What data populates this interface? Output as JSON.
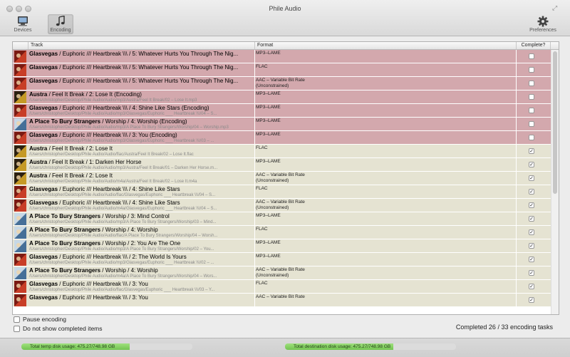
{
  "window": {
    "title": "Phile Audio"
  },
  "toolbar": {
    "devices_label": "Devices",
    "encoding_label": "Encoding",
    "preferences_label": "Preferences"
  },
  "table": {
    "headers": {
      "track": "Track",
      "format": "Format",
      "complete": "Complete?"
    },
    "rows": [
      {
        "art": "red",
        "bold": "Glasvegas",
        "rest": " / Euphoric /// Heartbreak \\\\\\ / 5: Whatever Hurts You Through The Nig...",
        "path": "",
        "format": "MP3–LAME",
        "complete": false
      },
      {
        "art": "red",
        "bold": "Glasvegas",
        "rest": " / Euphoric /// Heartbreak \\\\\\ / 5: Whatever Hurts You Through The Nig...",
        "path": "",
        "format": "FLAC",
        "complete": false
      },
      {
        "art": "red",
        "bold": "Glasvegas",
        "rest": " / Euphoric /// Heartbreak \\\\\\ / 5: Whatever Hurts You Through The Nig...",
        "path": "",
        "format": "AAC – Variable Bit Rate\n(Unconstrained)",
        "complete": false
      },
      {
        "art": "yellow",
        "bold": "Austra",
        "rest": " / Feel It Break / 2: Lose It (Encoding)",
        "path": "/Users/christopher/Desktop/Phile Audio/Audio/mp3/Austra/Feel It Break/02 – Lose It.mp3",
        "format": "MP3–LAME",
        "complete": false
      },
      {
        "art": "red",
        "bold": "Glasvegas",
        "rest": " / Euphoric /// Heartbreak \\\\\\ / 4: Shine Like Stars (Encoding)",
        "path": "/Users/christopher/Desktop/Phile Audio/Audio/mp3/Glasvegas/Euphoric ___ Heartbreak \\\\\\/04 – S...",
        "format": "MP3–LAME",
        "complete": false
      },
      {
        "art": "blue",
        "bold": "A Place To Bury Strangers",
        "rest": " / Worship / 4: Worship (Encoding)",
        "path": "/Users/christopher/Desktop/Phile Audio/Audio/mp3/A Place To Bury Strangers/Worship/04 – Worship.mp3",
        "format": "MP3–LAME",
        "complete": false
      },
      {
        "art": "red",
        "bold": "Glasvegas",
        "rest": " / Euphoric /// Heartbreak \\\\\\ / 3: You (Encoding)",
        "path": "/Users/christopher/Desktop/Phile Audio/Audio/mp3/Glasvegas/Euphoric ___ Heartbreak \\\\\\/03 – ...",
        "format": "MP3–LAME",
        "complete": false
      },
      {
        "art": "yellow",
        "bold": "Austra",
        "rest": " / Feel It Break / 2: Lose It",
        "path": "/Users/christopher/Desktop/Phile Audio/Audio/flac/Austra/Feel It Break/02 – Lose It.flac",
        "format": "FLAC",
        "complete": true
      },
      {
        "art": "yellow",
        "bold": "Austra",
        "rest": " / Feel It Break / 1: Darken Her Horse",
        "path": "/Users/christopher/Desktop/Phile Audio/Audio/mp3/Austra/Feel It Break/01 – Darken Her Horse.m...",
        "format": "MP3–LAME",
        "complete": true
      },
      {
        "art": "yellow",
        "bold": "Austra",
        "rest": " / Feel It Break / 2: Lose It",
        "path": "/Users/christopher/Desktop/Phile Audio/Audio/m4a/Austra/Feel It Break/02 – Lose It.m4a",
        "format": "AAC – Variable Bit Rate\n(Unconstrained)",
        "complete": true
      },
      {
        "art": "red",
        "bold": "Glasvegas",
        "rest": " / Euphoric /// Heartbreak \\\\\\ / 4: Shine Like Stars",
        "path": "/Users/christopher/Desktop/Phile Audio/Audio/flac/Glasvegas/Euphoric ___ Heartbreak \\\\\\/04 – S...",
        "format": "FLAC",
        "complete": true
      },
      {
        "art": "red",
        "bold": "Glasvegas",
        "rest": " / Euphoric /// Heartbreak \\\\\\ / 4: Shine Like Stars",
        "path": "/Users/christopher/Desktop/Phile Audio/Audio/m4a/Glasvegas/Euphoric ___ Heartbreak \\\\\\/04 – S...",
        "format": "AAC – Variable Bit Rate\n(Unconstrained)",
        "complete": true
      },
      {
        "art": "blue",
        "bold": "A Place To Bury Strangers",
        "rest": " / Worship / 3: Mind Control",
        "path": "/Users/christopher/Desktop/Phile Audio/Audio/mp3/A Place To Bury Strangers/Worship/03 – Mind...",
        "format": "MP3–LAME",
        "complete": true
      },
      {
        "art": "blue",
        "bold": "A Place To Bury Strangers",
        "rest": " / Worship / 4: Worship",
        "path": "/Users/christopher/Desktop/Phile Audio/Audio/flac/A Place To Bury Strangers/Worship/04 – Worsh...",
        "format": "FLAC",
        "complete": true
      },
      {
        "art": "blue",
        "bold": "A Place To Bury Strangers",
        "rest": " / Worship / 2: You Are The One",
        "path": "/Users/christopher/Desktop/Phile Audio/Audio/mp3/A Place To Bury Strangers/Worship/02 – You...",
        "format": "MP3–LAME",
        "complete": true
      },
      {
        "art": "red",
        "bold": "Glasvegas",
        "rest": " / Euphoric /// Heartbreak \\\\\\ / 2: The World Is Yours",
        "path": "/Users/christopher/Desktop/Phile Audio/Audio/mp3/Glasvegas/Euphoric ___ Heartbreak \\\\\\/02 – ...",
        "format": "MP3–LAME",
        "complete": true
      },
      {
        "art": "blue",
        "bold": "A Place To Bury Strangers",
        "rest": " / Worship / 4: Worship",
        "path": "/Users/christopher/Desktop/Phile Audio/Audio/m4a/A Place To Bury Strangers/Worship/04 – Wors...",
        "format": "AAC – Variable Bit Rate\n(Unconstrained)",
        "complete": true
      },
      {
        "art": "red",
        "bold": "Glasvegas",
        "rest": " / Euphoric /// Heartbreak \\\\\\ / 3: You",
        "path": "/Users/christopher/Desktop/Phile Audio/Audio/flac/Glasvegas/Euphoric ___ Heartbreak \\\\\\/03 – Y...",
        "format": "FLAC",
        "complete": true
      },
      {
        "art": "red",
        "bold": "Glasvegas",
        "rest": " / Euphoric /// Heartbreak \\\\\\ / 3: You",
        "path": "",
        "format": "AAC – Variable Bit Rate",
        "complete": true
      }
    ]
  },
  "options": {
    "pause_label": "Pause encoding",
    "hide_completed_label": "Do not show completed items"
  },
  "status": {
    "completed_text": "Completed 26 / 33 encoding tasks"
  },
  "disk": {
    "temp_label": "Total temp disk usage: 475.27/748.98 GB",
    "temp_fraction": 0.635,
    "dest_label": "Total destination disk usage: 475.27/748.98 GB",
    "dest_fraction": 0.635
  },
  "colors": {
    "pending_row": "#d3a8ad",
    "done_row": "#e5e3d2",
    "disk_fill": "#73c451"
  }
}
